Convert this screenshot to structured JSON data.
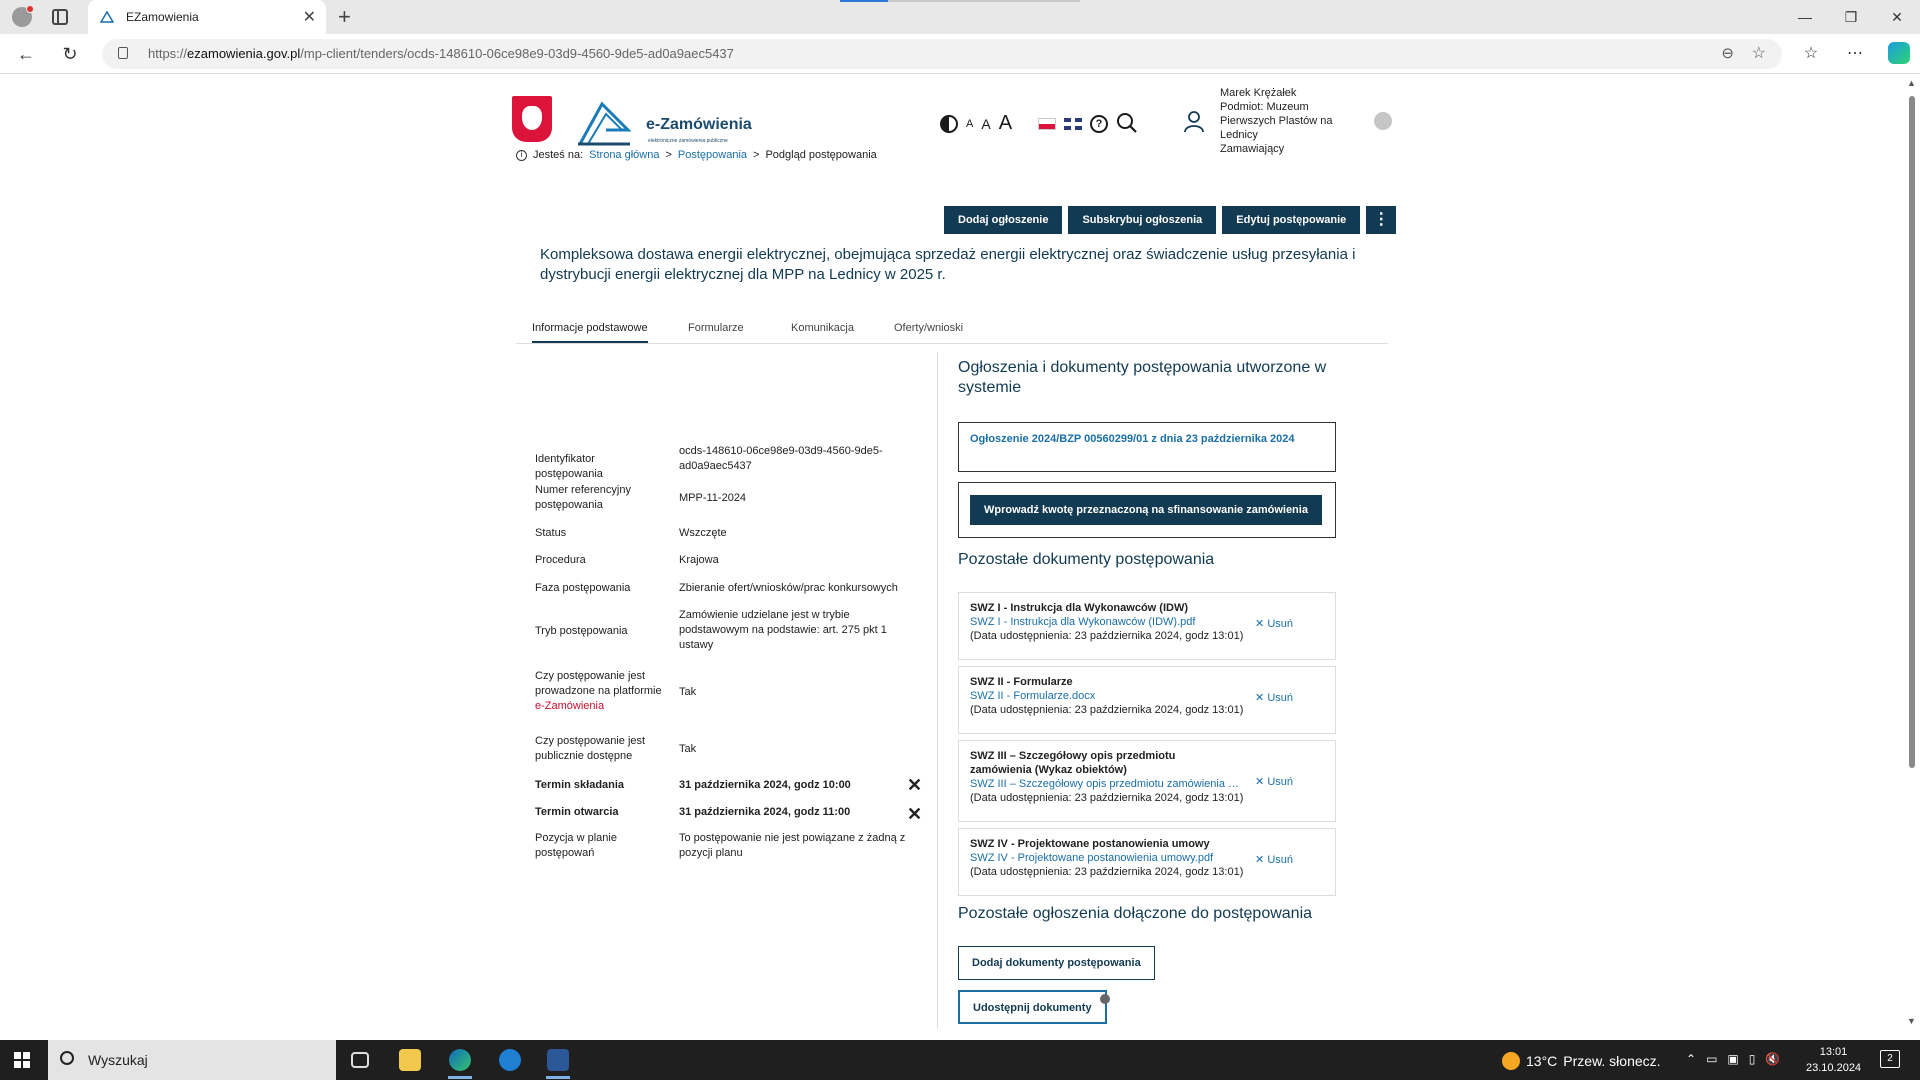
{
  "browser": {
    "tab_title": "EZamowienia",
    "url_domain": "ezamowienia.gov.pl",
    "url_path": "/mp-client/tenders/ocds-148610-06ce98e9-03d9-4560-9de5-ad0a9aec5437",
    "url_scheme": "https://"
  },
  "header": {
    "logo_name": "e-Zamówienia",
    "logo_sub": "elektroniczne zamówienia publiczne",
    "font_small": "A",
    "font_medium": "A",
    "font_large": "A",
    "user_lines": [
      "Marek Krężałek",
      "Podmiot: Muzeum Pierwszych Plastów na Lednicy",
      "Zamawiający"
    ]
  },
  "breadcrumb": {
    "prefix": "Jesteś na:",
    "items": [
      "Strona główna",
      "Postępowania",
      "Podgląd postępowania"
    ],
    "sep": ">"
  },
  "actions": {
    "add_notice": "Dodaj ogłoszenie",
    "subscribe": "Subskrybuj ogłoszenia",
    "edit": "Edytuj postępowanie",
    "more": "⋮"
  },
  "tender_title": "Kompleksowa dostawa energii elektrycznej, obejmująca sprzedaż energii elektrycznej oraz świadczenie usług przesyłania i dystrybucji energii elektrycznej dla MPP na Lednicy w 2025 r.",
  "tabs": [
    "Informacje podstawowe",
    "Formularze",
    "Komunikacja",
    "Oferty/wnioski"
  ],
  "info": [
    {
      "k": "Identyfikator postępowania",
      "v": "ocds-148610-06ce98e9-03d9-4560-9de5-ad0a9aec5437"
    },
    {
      "k": "Numer referencyjny postępowania",
      "v": "MPP-11-2024"
    },
    {
      "k": "Status",
      "v": "Wszczęte"
    },
    {
      "k": "Procedura",
      "v": "Krajowa"
    },
    {
      "k": "Faza postępowania",
      "v": "Zbieranie ofert/wniosków/prac konkursowych"
    },
    {
      "k": "Tryb postępowania",
      "v": "Zamówienie udzielane jest w trybie podstawowym na podstawie: art. 275 pkt 1 ustawy"
    },
    {
      "k": "Czy postępowanie jest prowadzone na platformie",
      "k_red": "e-Zamówienia",
      "v": "Tak"
    },
    {
      "k": "Czy postępowanie jest publicznie dostępne",
      "v": "Tak"
    },
    {
      "k": "Termin składania",
      "v": "31 października 2024, godz 10:00"
    },
    {
      "k": "Termin otwarcia",
      "v": "31 października 2024, godz 11:00"
    },
    {
      "k": "Pozycja w planie postępowań",
      "v": "To postępowanie nie jest powiązane z żadną z pozycji planu"
    }
  ],
  "right": {
    "sec1_title": "Ogłoszenia i dokumenty postępowania utworzone w systemie",
    "notice_link": "Ogłoszenie 2024/BZP 00560299/01 z dnia 23 października 2024",
    "amount_btn": "Wprowadź kwotę przeznaczoną na sfinansowanie zamówienia",
    "sec2_title": "Pozostałe dokumenty postępowania",
    "docs": [
      {
        "title": "SWZ I - Instrukcja dla Wykonawców (IDW)",
        "file": "SWZ I - Instrukcja dla Wykonawców (IDW).pdf",
        "date": "(Data udostępnienia: 23 października 2024, godz 13:01)",
        "remove": "Usuń"
      },
      {
        "title": "SWZ II - Formularze",
        "file": "SWZ II - Formularze.docx",
        "date": "(Data udostępnienia: 23 października 2024, godz 13:01)",
        "remove": "Usuń"
      },
      {
        "title": "SWZ III – Szczegółowy opis przedmiotu zamówienia (Wykaz obiektów)",
        "file": "SWZ III – Szczegółowy opis przedmiotu zamówienia (...",
        "date": "(Data udostępnienia: 23 października 2024, godz 13:01)",
        "remove": "Usuń"
      },
      {
        "title": "SWZ IV - Projektowane postanowienia umowy",
        "file": "SWZ IV - Projektowane postanowienia umowy.pdf",
        "date": "(Data udostępnienia: 23 października 2024, godz 13:01)",
        "remove": "Usuń"
      }
    ],
    "sec3_title": "Pozostałe ogłoszenia dołączone do postępowania",
    "add_docs_btn": "Dodaj dokumenty postępowania",
    "share_btn": "Udostępnij dokumenty"
  },
  "taskbar": {
    "search_placeholder": "Wyszukaj",
    "weather": "13°C",
    "weather_desc": "Przew. słonecz.",
    "time": "13:01",
    "date": "23.10.2024",
    "notifications": "2"
  }
}
